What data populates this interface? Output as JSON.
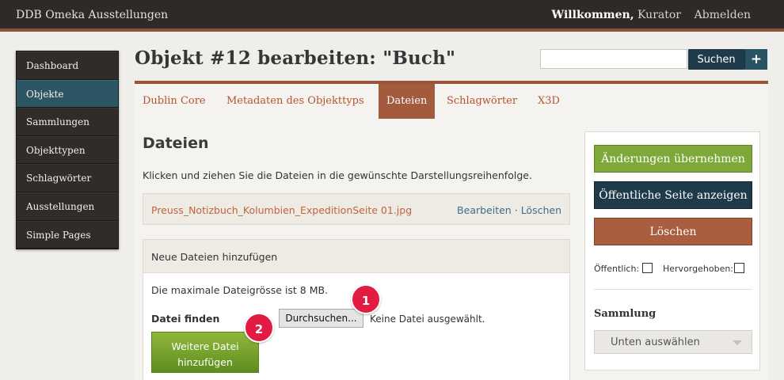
{
  "header": {
    "site_title": "DDB Omeka Ausstellungen",
    "welcome_prefix": "Willkommen,",
    "username": "Kurator",
    "logout": "Abmelden"
  },
  "sidebar": {
    "items": [
      {
        "label": "Dashboard",
        "active": false
      },
      {
        "label": "Objekte",
        "active": true
      },
      {
        "label": "Sammlungen",
        "active": false
      },
      {
        "label": "Objekttypen",
        "active": false
      },
      {
        "label": "Schlagwörter",
        "active": false
      },
      {
        "label": "Ausstellungen",
        "active": false
      },
      {
        "label": "Simple Pages",
        "active": false
      }
    ]
  },
  "page": {
    "title": "Objekt #12 bearbeiten: \"Buch\""
  },
  "search": {
    "value": "",
    "button": "Suchen",
    "plus": "+"
  },
  "tabs": [
    {
      "label": "Dublin Core",
      "active": false
    },
    {
      "label": "Metadaten des Objekttyps",
      "active": false
    },
    {
      "label": "Dateien",
      "active": true
    },
    {
      "label": "Schlagwörter",
      "active": false
    },
    {
      "label": "X3D",
      "active": false
    }
  ],
  "files": {
    "heading": "Dateien",
    "instruction": "Klicken und ziehen Sie die Dateien in die gewünschte Darstellungsreihenfolge.",
    "existing_file": "Preuss_Notizbuch_Kolumbien_ExpeditionSeite 01.jpg",
    "edit": "Bearbeiten",
    "separator": "·",
    "delete": "Löschen"
  },
  "new_files": {
    "heading": "Neue Dateien hinzufügen",
    "max_size": "Die maximale Dateigrösse ist 8 MB.",
    "file_label": "Datei finden",
    "browse": "Durchsuchen...",
    "no_file": "Keine Datei ausgewählt.",
    "add_more": "Weitere Datei hinzufügen"
  },
  "actions": {
    "save": "Änderungen übernehmen",
    "view_public": "Öffentliche Seite anzeigen",
    "delete": "Löschen",
    "public_label": "Öffentlich:",
    "featured_label": "Hervorgehoben:",
    "collection_label": "Sammlung",
    "collection_select": "Unten auswählen"
  },
  "markers": [
    "1",
    "2"
  ],
  "colors": {
    "topbar": "#2e2a27",
    "accent": "#98553a",
    "active_nav": "#2d5664",
    "green": "#7ea83a",
    "navy": "#1f3b49",
    "marker": "#e21b43"
  }
}
